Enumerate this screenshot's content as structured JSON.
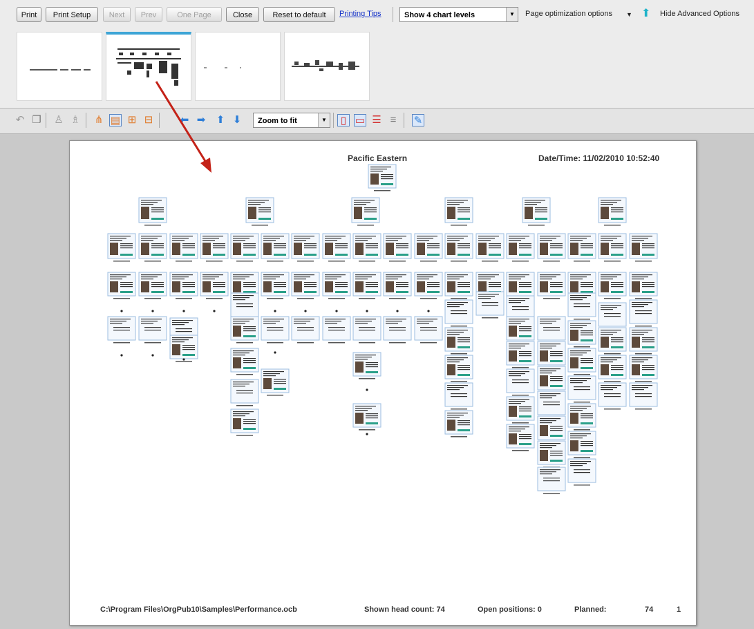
{
  "toolbar": {
    "print": "Print",
    "print_setup": "Print Setup",
    "next": "Next",
    "prev": "Prev",
    "one_page": "One Page",
    "close": "Close",
    "reset": "Reset to default",
    "printing_tips": "Printing Tips",
    "levels": "Show 4 chart levels",
    "page_opt": "Page optimization options",
    "hide_adv": "Hide Advanced Options"
  },
  "view_toolbar": {
    "zoom": "Zoom to fit"
  },
  "document": {
    "title": "Pacific Eastern",
    "date_time": "Date/Time:  11/02/2010  10:52:40",
    "path": "C:\\Program Files\\OrgPub10\\Samples\\Performance.ocb",
    "head_count": "Shown head count: 74",
    "open_positions": "Open positions: 0",
    "planned_label": "Planned:",
    "planned_value": "74",
    "page_number": "1"
  },
  "colors": {
    "card_border": "#9bbde0",
    "accent_teal": "#2ba08a",
    "arrow": "#c42218",
    "tab_accent": "#3ea5d6"
  },
  "icons": {
    "undo": "undo-icon",
    "copy": "copy-icon",
    "left": "arrow-left-icon",
    "right": "arrow-right-icon",
    "up": "arrow-up-icon",
    "down": "arrow-down-icon"
  }
}
